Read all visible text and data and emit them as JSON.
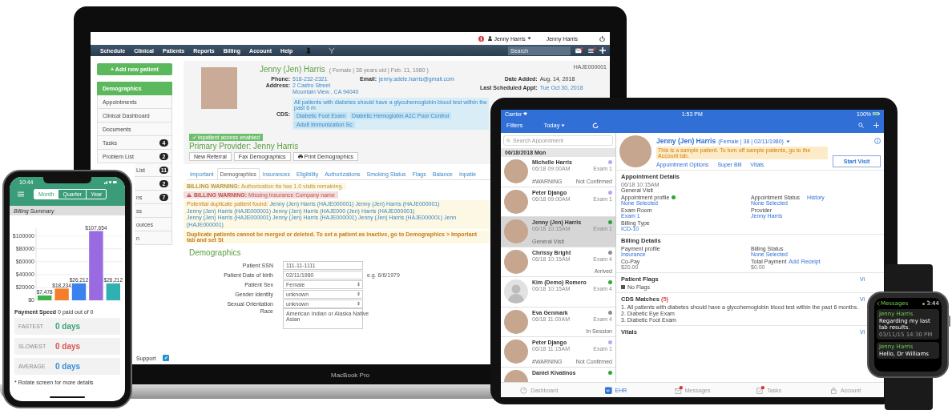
{
  "laptop": {
    "brand": "MacBook Pro",
    "topbar": {
      "user_menu": "Jenny Harris",
      "user_name": "Jenny Harris"
    },
    "nav": {
      "items": [
        "Schedule",
        "Clinical",
        "Patients",
        "Reports",
        "Billing",
        "Account",
        "Help"
      ],
      "search": {
        "placeholder": "Search"
      }
    },
    "sidebar": {
      "add_button": "+ Add new patient",
      "footer": "Support",
      "items": [
        {
          "label": "Demographics",
          "selected": true,
          "kind": "full"
        },
        {
          "label": "Appointments",
          "selected": false,
          "kind": "full"
        },
        {
          "label": "Clinical Dashboard",
          "selected": false,
          "kind": "full"
        },
        {
          "label": "Documents",
          "selected": false,
          "kind": "full"
        },
        {
          "label": "Tasks",
          "badge": "4",
          "selected": false,
          "kind": "full"
        },
        {
          "label": "Problem List",
          "badge": "2",
          "selected": false,
          "kind": "full"
        },
        {
          "label": "List",
          "badge": "11",
          "selected": false,
          "kind": "partial"
        },
        {
          "badge": "2",
          "selected": false,
          "kind": "partial"
        },
        {
          "label": "ns",
          "badge": "7",
          "selected": false,
          "kind": "partial"
        },
        {
          "label": "ss",
          "selected": false,
          "kind": "partial"
        },
        {
          "label": "ources",
          "selected": false,
          "kind": "partial"
        },
        {
          "label": "n",
          "selected": false,
          "kind": "partial"
        }
      ]
    },
    "patient": {
      "name": "Jenny (Jen) Harris",
      "summary": "( Female | 38 years old | Feb. 11, 1980 )",
      "id": "HAJE000001",
      "phone_label": "Phone:",
      "phone": "518-232-2321",
      "address_label": "Address:",
      "address": [
        "2 Castro Street",
        "Mountain View , CA 94040"
      ],
      "email_label": "Email:",
      "email": "jenny.adele.harris@gmail.com",
      "dates": [
        {
          "label": "Date Added:",
          "value": "Aug. 14, 2018"
        },
        {
          "label": "Last Scheduled Appt:",
          "value": "Tue Oct 30, 2018"
        }
      ],
      "cds_label": "CDS:",
      "cds_text": "All patients with diabetes should have a glycohemoglobin blood test within the past 6 m",
      "cds_tags": [
        "Diabetic Foot Exam",
        "Diabetic Hemoglobin A1C Poor Control",
        "Adult Immunization Sc"
      ],
      "access": "inpatient access enabled",
      "provider": "Primary Provider: Jenny Harris",
      "buttons": [
        {
          "label": "New Referral",
          "kind": "plain"
        },
        {
          "label": "Fax Demographics",
          "kind": "plain"
        },
        {
          "label": "Print Demographics",
          "kind": "print"
        }
      ]
    },
    "tabs": [
      {
        "label": "Important",
        "selected": false
      },
      {
        "label": "Demographics",
        "selected": true
      },
      {
        "label": "Insurances",
        "selected": false
      },
      {
        "label": "Eligibility",
        "selected": false
      },
      {
        "label": "Authorizations",
        "selected": false
      },
      {
        "label": "Smoking Status",
        "selected": false
      },
      {
        "label": "Flags",
        "selected": false
      },
      {
        "label": "Balance",
        "selected": false
      },
      {
        "label": "Inpatie",
        "selected": false
      }
    ],
    "warnings": [
      {
        "kind": "billing",
        "label": "BILLING WARNING:",
        "text": "Authorization #a has 1.0 visits remaining."
      },
      {
        "kind": "alert",
        "label": "BILLING WARNING:",
        "text": "Missing Insurance Company name"
      },
      {
        "kind": "duplicate",
        "label": "Potential duplicate patient found:",
        "links": [
          "Jenny (Jen) Harris (HAJE000001)",
          "Jenny (Jen) Harris (HAJE000001)",
          "Jenny (Jen) Harris (HAJE000001)",
          "Jenny (Jen) Harris (HAJE000",
          "(Jen) Harris (HAJE000001)",
          "Jenny (Jen) Harris (HAJE000001)",
          "Jenny (Jen) Harris (HAJE000001)",
          "Jenny (Jen) Harris (HAJE000001)",
          "Jenn",
          "(HAJE000001)"
        ]
      },
      {
        "kind": "note",
        "text": "Duplicate patients cannot be merged or deleted. To set a patient as inactive, go to Demographics > Important tab and set St"
      }
    ],
    "section_title": "Demographics",
    "form": [
      {
        "label": "Patient SSN",
        "kind": "text",
        "value": "111-11-1111"
      },
      {
        "label": "Patient Date of birth",
        "kind": "text",
        "value": "02/11/1980",
        "hint": "e.g. 6/6/1979"
      },
      {
        "label": "Patient Sex",
        "kind": "select",
        "value": "Female"
      },
      {
        "label": "Gender Identity",
        "kind": "select",
        "value": "unknown"
      },
      {
        "label": "Sexual Orientation",
        "kind": "select",
        "value": "unknown"
      },
      {
        "label": "Race",
        "kind": "list",
        "options": [
          "American Indian or Alaska Native",
          "Asian"
        ]
      }
    ]
  },
  "phone": {
    "time": "10:44",
    "segments": [
      {
        "label": "Month",
        "selected": true
      },
      {
        "label": "Quarter",
        "selected": false
      },
      {
        "label": "Year",
        "selected": false
      }
    ],
    "title": "Billing Summary",
    "chart_data": {
      "type": "bar",
      "grid": true,
      "series": [
        {
          "values": [
            7478,
            18234,
            26212,
            107654,
            26212
          ]
        }
      ],
      "colors": [
        "#3db14a",
        "#f47e2a",
        "#3b82ef",
        "#9a6ae0",
        "#2fb1b1"
      ],
      "value_labels": [
        "$7,478",
        "$18,234",
        "$26,212",
        "$107,654",
        "$26,212"
      ],
      "ylim": [
        0,
        112000
      ],
      "yticks": [
        {
          "value": 0,
          "label": "$0"
        },
        {
          "value": 20000,
          "label": "$20000"
        },
        {
          "value": 40000,
          "label": "$40000"
        },
        {
          "value": 60000,
          "label": "$60000"
        },
        {
          "value": 80000,
          "label": "$80000"
        },
        {
          "value": 100000,
          "label": "$100000"
        }
      ]
    },
    "speed_label": "Payment Speed",
    "speed_text": "0 paid out of 0",
    "speeds": [
      {
        "label": "FASTEST",
        "value": "0 days",
        "color": "#3aa57a"
      },
      {
        "label": "SLOWEST",
        "value": "0 days",
        "color": "#d9534f"
      },
      {
        "label": "AVERAGE",
        "value": "0 days",
        "color": "#3b8fd6"
      }
    ],
    "note": "* Rotate screen for more details"
  },
  "tablet": {
    "status": {
      "carrier": "Carrier",
      "time": "1:53 PM",
      "battery": "100%"
    },
    "nav": {
      "filters": "Filters",
      "today": "Today"
    },
    "search": {
      "placeholder": "Search Appointment"
    },
    "date": "06/18/2018 Mon",
    "appointments": [
      {
        "name": "Michelle Harris",
        "time": "06/18 09:00AM",
        "room": "Exam 1",
        "tag": "#WARNING",
        "status": "Not Confirmed",
        "color": "#b7a8ee",
        "selected": false,
        "kind": "photo"
      },
      {
        "name": "Peter Django",
        "time": "06/18 09:00AM",
        "room": "Exam 1",
        "color": "#b7a8ee",
        "selected": false,
        "kind": "photo"
      },
      {
        "name": "Jenny (Jen) Harris",
        "time": "06/18 10:15AM",
        "room": "Exam 1",
        "tag": "General Visit",
        "color": "#2ea53a",
        "selected": true,
        "kind": "photo"
      },
      {
        "name": "Chrissy Bright",
        "time": "06/18 10:15AM",
        "room": "Exam 4",
        "status": "Arrived",
        "color": "#8c8c8c",
        "selected": false,
        "kind": "photo"
      },
      {
        "name": "Kim (Demo) Romero",
        "time": "06/18 10:15AM",
        "room": "Exam 4",
        "color": "#2ea53a",
        "selected": false,
        "kind": "silhouette"
      },
      {
        "name": "Eva Genmark",
        "time": "06/18 11:00AM",
        "room": "Exam 4",
        "status": "In Session",
        "color": "#8c8c8c",
        "selected": false,
        "kind": "photo"
      },
      {
        "name": "Peter Django",
        "time": "06/18 11:15AM",
        "room": "Exam 1",
        "tag": "#WARNING",
        "status": "Not Confirmed",
        "color": "#b7a8ee",
        "selected": false,
        "kind": "photo"
      },
      {
        "name": "Daniel Kivatinos",
        "color": "#2ea53a",
        "selected": false,
        "kind": "photo"
      }
    ],
    "patient": {
      "name": "Jenny (Jen) Harris",
      "summary": "(Female | 38 | 02/11/1980)",
      "banner": "This is a sample patient. To turn off sample patients, go to the Account tab.",
      "links": [
        "Appointment Options",
        "Super Bill",
        "Vitals"
      ],
      "action": "Start Visit"
    },
    "appointment": {
      "title": "Appointment Details",
      "time": "06/18 10:15AM",
      "type": "General Visit",
      "fields": [
        {
          "label": "Appointment profile",
          "value": "None Selected",
          "kind": "status"
        },
        {
          "label": "Appointment Status",
          "link": "History",
          "value": "None Selected",
          "kind": "link"
        },
        {
          "label": "Exam Room",
          "value": "Exam 1",
          "kind": "link"
        },
        {
          "label": "Provider",
          "value": "Jenny Harris",
          "kind": "link"
        },
        {
          "label": "Billing Type",
          "value": "ICD-10",
          "kind": "link"
        }
      ]
    },
    "billing": {
      "title": "Billing Details",
      "fields": [
        {
          "label": "Payment profile",
          "value": "Insurance",
          "kind": "link"
        },
        {
          "label": "Billing Status",
          "value": "None Selected",
          "kind": "link"
        },
        {
          "label": "Co-Pay",
          "value": "$20.00",
          "kind": "amount"
        },
        {
          "label": "Total Payment",
          "links": [
            "Add",
            "Receipt"
          ],
          "value": "$0.00",
          "kind": "amount"
        }
      ]
    },
    "flags": {
      "title": "Patient Flags",
      "items": [
        "No Flags"
      ],
      "more": "Vi"
    },
    "cds": {
      "title": "CDS Matches",
      "count": "(5)",
      "items": [
        "1. All patients with diabetes should have a glycohemoglobin blood test within the past 6 months.",
        "2. Diabetic Eye Exam",
        "3. Diabetic Foot Exam"
      ],
      "more": "Vi"
    },
    "vitals": {
      "title": "Vitals",
      "more": "Vi"
    },
    "tabs": [
      {
        "label": "Dashboard",
        "selected": false,
        "kind": "dashboard",
        "badge": false
      },
      {
        "label": "EHR",
        "selected": true,
        "kind": "ehr",
        "badge": false
      },
      {
        "label": "Messages",
        "selected": false,
        "kind": "messages",
        "badge": true
      },
      {
        "label": "Tasks",
        "selected": false,
        "kind": "tasks",
        "badge": true
      },
      {
        "label": "Account",
        "selected": false,
        "kind": "account",
        "badge": false
      }
    ]
  },
  "watch": {
    "back": "Messages",
    "time": "3:44",
    "messages": [
      {
        "sender": "Jenny Harris",
        "text": "Regarding my last lab results.",
        "time": "03/11/15 14:30 PM"
      },
      {
        "sender": "Jenny Harris",
        "text": "Hello, Dr Williams"
      }
    ]
  }
}
